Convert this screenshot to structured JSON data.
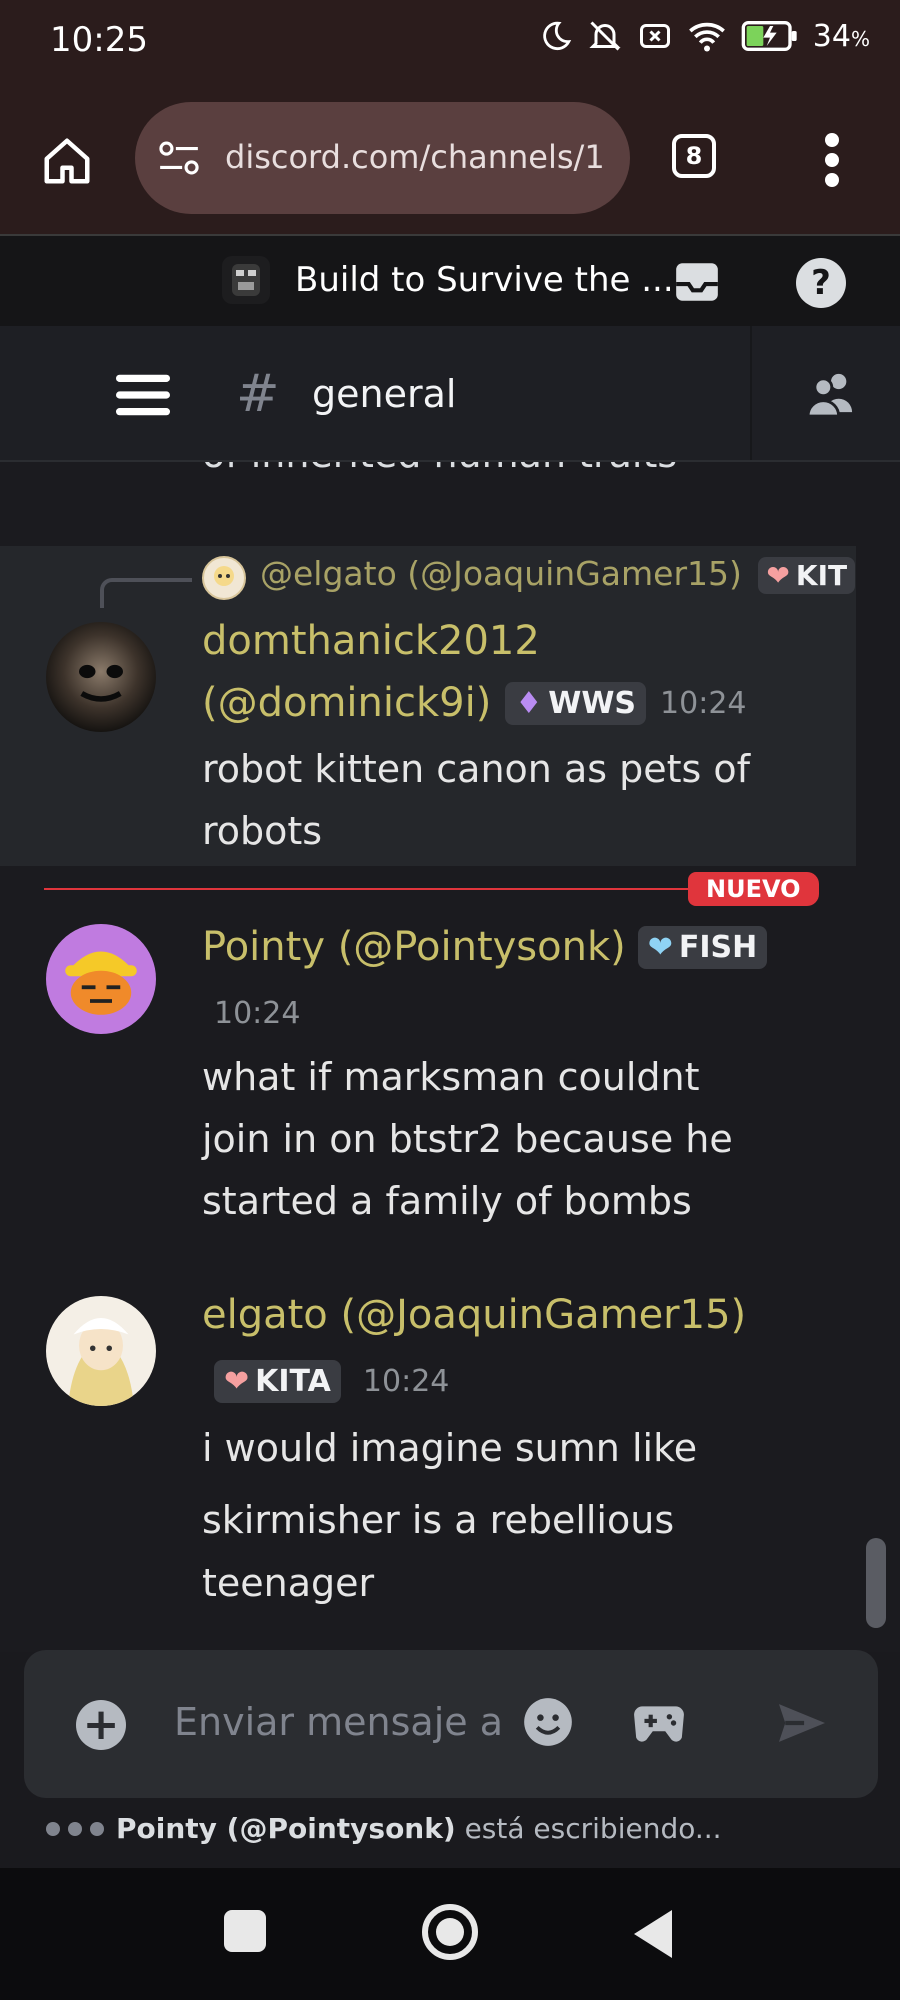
{
  "status_bar": {
    "time": "10:25",
    "battery_percent": "34",
    "battery_unit": "%"
  },
  "browser": {
    "url": "discord.com/channels/1",
    "tab_count": "8"
  },
  "guild": {
    "name": "Build to Survive the ..."
  },
  "channel": {
    "hash": "#",
    "name": "general"
  },
  "chat": {
    "cut_off_text": "of inherited human traits",
    "new_label": "NUEVO",
    "messages": [
      {
        "reply_to": "@elgato (@JoaquinGamer15)",
        "reply_badge": "KIT",
        "username_line1": "domthanick2012",
        "username_line2": "(@dominick9i)",
        "badge": "WWS",
        "time": "10:24",
        "lines": [
          "robot kitten canon as pets of",
          "robots"
        ]
      },
      {
        "username": "Pointy (@Pointysonk)",
        "badge": "FISH",
        "time": "10:24",
        "lines": [
          "what if marksman couldnt",
          "join in on btstr2 because he",
          "started a family of bombs"
        ]
      },
      {
        "username": "elgato (@JoaquinGamer15)",
        "badge": "KITA",
        "time": "10:24",
        "lines": [
          "i would imagine sumn like",
          "skirmisher is a rebellious",
          "teenager"
        ]
      }
    ]
  },
  "composer": {
    "placeholder": "Enviar mensaje a"
  },
  "typing": {
    "user": "Pointy (@Pointysonk)",
    "text": "está escribiendo..."
  },
  "colors": {
    "username": "#c8bf6a",
    "new_divider": "#e0353c",
    "background": "#1b1b1f"
  }
}
